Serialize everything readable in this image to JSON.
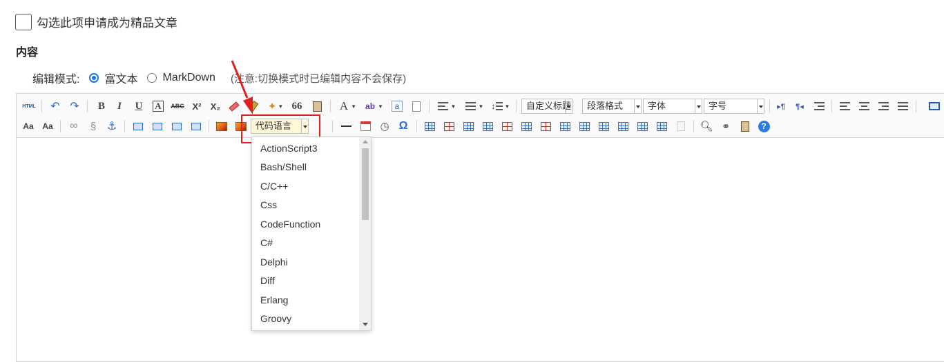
{
  "form": {
    "featured_label": "勾选此项申请成为精品文章",
    "content_title": "内容",
    "mode_label": "编辑模式:",
    "mode_options": [
      "富文本",
      "MarkDown"
    ],
    "selected_mode": "富文本",
    "mode_note": "(注意:切换模式时已编辑内容不会保存)"
  },
  "toolbar": {
    "html_label": "HTML",
    "bold": "B",
    "italic": "I",
    "underline": "U",
    "font_border": "A",
    "strike": "ABC",
    "superscript": "X²",
    "subscript": "X₂",
    "quote": "66",
    "font_color": "A",
    "bg_color": "ab",
    "link_a": "a",
    "custom_heading": "自定义标题",
    "paragraph_format": "段落格式",
    "font_family": "字体",
    "font_size": "字号",
    "ltr": "▸¶",
    "rtl": "¶◂",
    "aa_up": "Aa",
    "aa_down": "Aa",
    "code_language": "代码语言",
    "omega": "Ω",
    "help": "?"
  },
  "code_languages": [
    "ActionScript3",
    "Bash/Shell",
    "C/C++",
    "Css",
    "CodeFunction",
    "C#",
    "Delphi",
    "Diff",
    "Erlang",
    "Groovy"
  ],
  "colors": {
    "accent_blue": "#1a73e8",
    "highlight_red": "#e02020",
    "code_combo_bg": "#fff7d6"
  }
}
